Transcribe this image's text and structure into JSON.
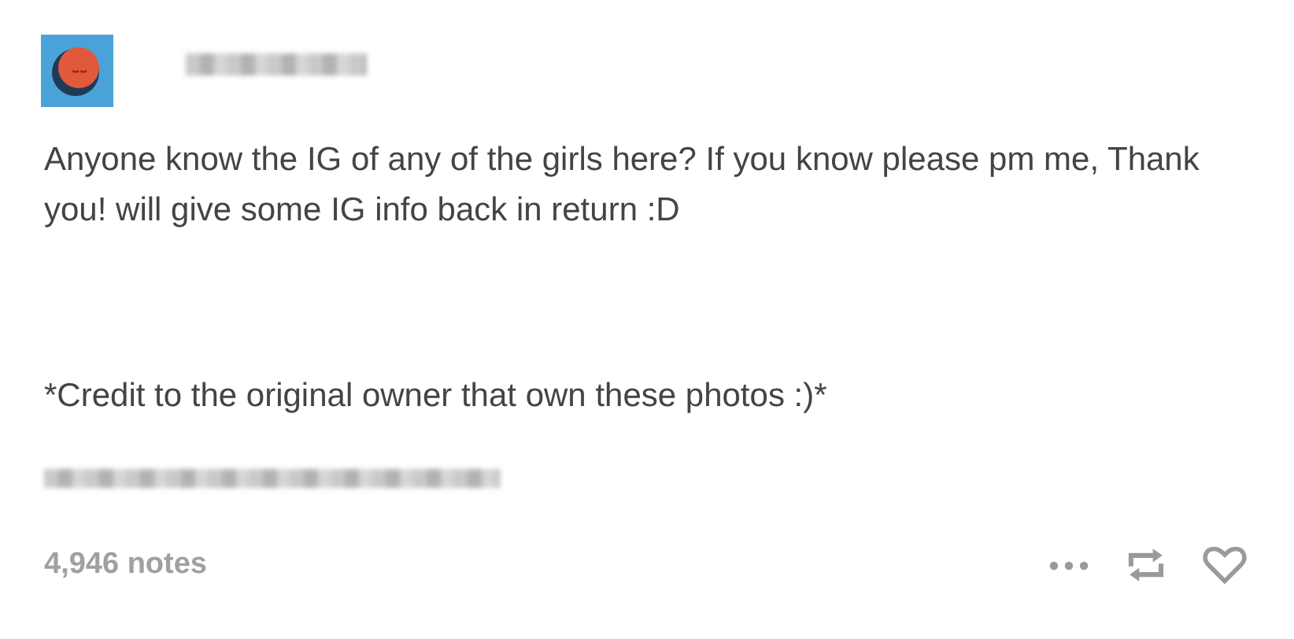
{
  "post": {
    "paragraphs": [
      "Anyone know the IG of any of the girls here? If you know please pm me, Thank you! will give some IG info back in return :D",
      "*Credit to the original owner that own these photos :)*"
    ]
  },
  "footer": {
    "notes": "4,946 notes"
  }
}
